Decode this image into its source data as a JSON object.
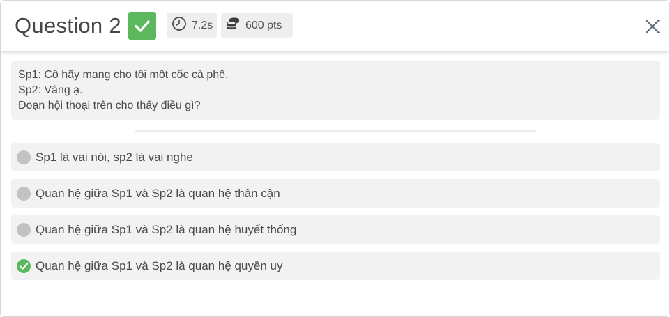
{
  "header": {
    "title": "Question 2",
    "status_icon": "check-icon",
    "time": {
      "icon": "clock-icon",
      "value": "7.2s"
    },
    "points": {
      "icon": "coins-icon",
      "value": "600 pts"
    },
    "close_icon": "close-icon"
  },
  "question": {
    "lines": [
      "Sp1: Cô hãy mang cho tôi một cốc cà phê.",
      "Sp2: Vâng ạ.",
      "Đoạn hội thoại trên cho thấy điều gì?"
    ]
  },
  "options": [
    {
      "label": "Sp1 là vai nói, sp2 là vai nghe",
      "state": "unselected"
    },
    {
      "label": "Quan hệ giữa Sp1 và Sp2 là quan hệ thân cận",
      "state": "unselected"
    },
    {
      "label": "Quan hệ giữa Sp1 và Sp2 là quan hệ huyết thống",
      "state": "unselected"
    },
    {
      "label": "Quan hệ giữa Sp1 và Sp2 là quan hệ quyền uy",
      "state": "correct"
    }
  ],
  "colors": {
    "correct": "#5cb85c",
    "neutral_dot": "#c2c2c2",
    "panel_bg": "#f2f2f2",
    "pill_bg": "#eeeeee"
  }
}
